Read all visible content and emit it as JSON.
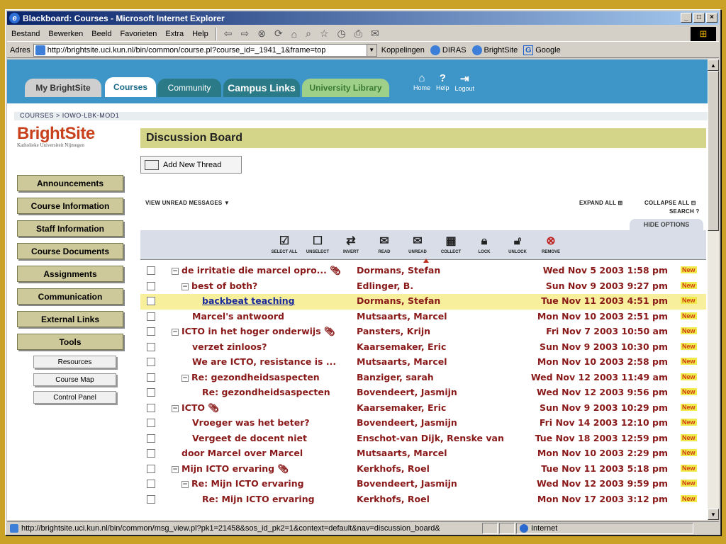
{
  "window": {
    "title": "Blackboard: Courses - Microsoft Internet Explorer"
  },
  "menu": [
    "Bestand",
    "Bewerken",
    "Beeld",
    "Favorieten",
    "Extra",
    "Help"
  ],
  "address": {
    "label": "Adres",
    "url": "http://brightsite.uci.kun.nl/bin/common/course.pl?course_id=_1941_1&frame=top"
  },
  "links_label": "Koppelingen",
  "links": [
    "DIRAS",
    "BrightSite",
    "Google"
  ],
  "tabs": [
    "My BrightSite",
    "Courses",
    "Community",
    "Campus Links",
    "University Library"
  ],
  "header_icons": [
    "Home",
    "Help",
    "Logout"
  ],
  "breadcrumb": "COURSES > IOWO-LBK-MOD1",
  "logo": {
    "title": "BrightSite",
    "subtitle": "Katholieke Universiteit Nijmegen"
  },
  "nav": [
    "Announcements",
    "Course Information",
    "Staff Information",
    "Course Documents",
    "Assignments",
    "Communication",
    "External Links",
    "Tools"
  ],
  "tools": [
    "Resources",
    "Course Map",
    "Control Panel"
  ],
  "board": {
    "title": "Discussion Board",
    "add_thread": "Add New Thread",
    "view_unread": "VIEW UNREAD MESSAGES",
    "expand_all": "EXPAND ALL",
    "collapse_all": "COLLAPSE ALL",
    "search": "SEARCH",
    "hide_options": "HIDE OPTIONS"
  },
  "actions": [
    "SELECT ALL",
    "UNSELECT",
    "INVERT",
    "READ",
    "UNREAD",
    "COLLECT",
    "LOCK",
    "UNLOCK",
    "REMOVE"
  ],
  "messages": [
    {
      "subject": "de irritatie die marcel opro...",
      "author": "Dormans, Stefan",
      "date": "Wed Nov 5 2003 1:58 pm",
      "badge": "New"
    },
    {
      "subject": "best of both?",
      "author": "Edlinger, B.",
      "date": "Sun Nov 9 2003 9:27 pm",
      "badge": "New"
    },
    {
      "subject": "backbeat teaching",
      "author": "Dormans, Stefan",
      "date": "Tue Nov 11 2003 4:51 pm",
      "badge": "New"
    },
    {
      "subject": "Marcel's antwoord",
      "author": "Mutsaarts, Marcel",
      "date": "Mon Nov 10 2003 2:51 pm",
      "badge": "New"
    },
    {
      "subject": "ICTO in het hoger onderwijs",
      "author": "Pansters, Krijn",
      "date": "Fri Nov 7 2003 10:50 am",
      "badge": "New"
    },
    {
      "subject": "verzet zinloos?",
      "author": "Kaarsemaker, Eric",
      "date": "Sun Nov 9 2003 10:30 pm",
      "badge": "New"
    },
    {
      "subject": "We are ICTO, resistance is ...",
      "author": "Mutsaarts, Marcel",
      "date": "Mon Nov 10 2003 2:58 pm",
      "badge": "New"
    },
    {
      "subject": "Re: gezondheidsaspecten",
      "author": "Banziger, sarah",
      "date": "Wed Nov 12 2003 11:49 am",
      "badge": "New"
    },
    {
      "subject": "Re: gezondheidsaspecten",
      "author": "Bovendeert, Jasmijn",
      "date": "Wed Nov 12 2003 9:56 pm",
      "badge": "New"
    },
    {
      "subject": "ICTO",
      "author": "Kaarsemaker, Eric",
      "date": "Sun Nov 9 2003 10:29 pm",
      "badge": "New"
    },
    {
      "subject": "Vroeger was het beter?",
      "author": "Bovendeert, Jasmijn",
      "date": "Fri Nov 14 2003 12:10 pm",
      "badge": "New"
    },
    {
      "subject": "Vergeet de docent niet",
      "author": "Enschot-van Dijk, Renske van",
      "date": "Tue Nov 18 2003 12:59 pm",
      "badge": "New"
    },
    {
      "subject": "door Marcel over Marcel",
      "author": "Mutsaarts, Marcel",
      "date": "Mon Nov 10 2003 2:29 pm",
      "badge": "New"
    },
    {
      "subject": "Mijn ICTO ervaring",
      "author": "Kerkhofs, Roel",
      "date": "Tue Nov 11 2003 5:18 pm",
      "badge": "New"
    },
    {
      "subject": "Re: Mijn ICTO ervaring",
      "author": "Bovendeert, Jasmijn",
      "date": "Wed Nov 12 2003 9:59 pm",
      "badge": "New"
    },
    {
      "subject": "Re: Mijn ICTO ervaring",
      "author": "Kerkhofs, Roel",
      "date": "Mon Nov 17 2003 3:12 pm",
      "badge": "New"
    }
  ],
  "status": {
    "url": "http://brightsite.uci.kun.nl/bin/common/msg_view.pl?pk1=21458&sos_id_pk2=1&context=default&nav=discussion_board&",
    "zone": "Internet"
  }
}
